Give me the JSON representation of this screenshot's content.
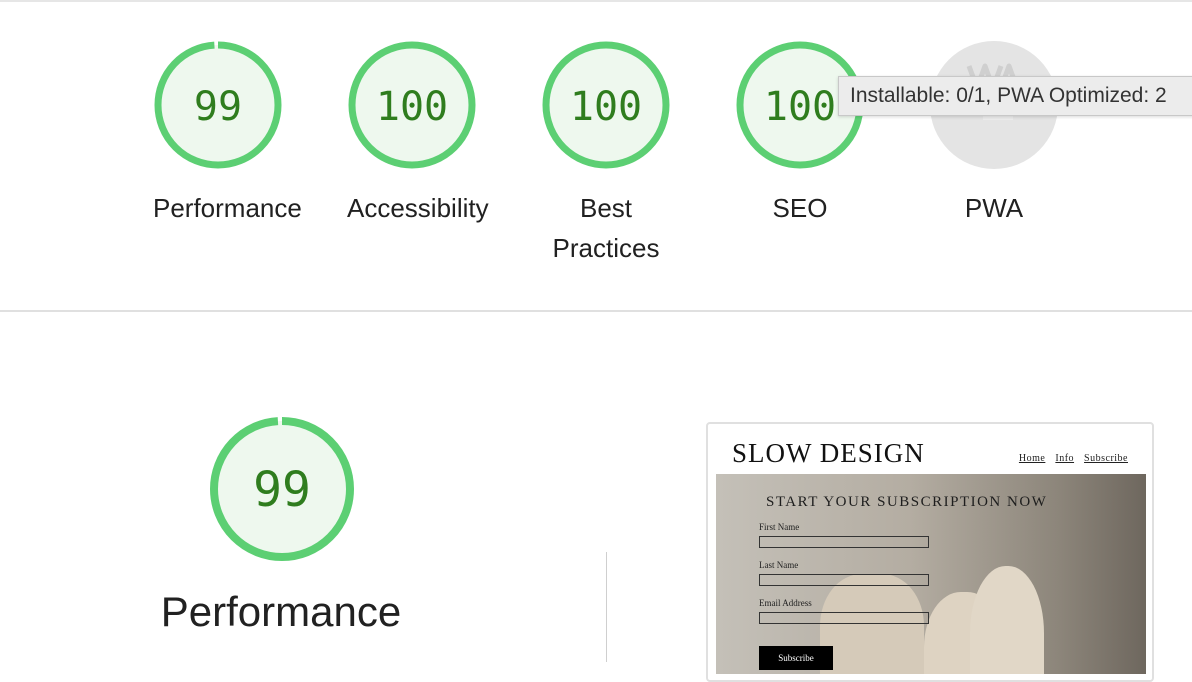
{
  "categories": [
    {
      "label": "Performance",
      "score": "99",
      "value": 99
    },
    {
      "label": "Accessibility",
      "score": "100",
      "value": 100
    },
    {
      "label": "Best Practices",
      "score": "100",
      "value": 100
    },
    {
      "label": "SEO",
      "score": "100",
      "value": 100
    },
    {
      "label": "PWA",
      "score": "",
      "value": null
    }
  ],
  "tooltip": "Installable: 0/1, PWA Optimized: 2",
  "performance": {
    "score": "99",
    "value": 99,
    "title": "Performance"
  },
  "preview": {
    "brand": "SLOW DESIGN",
    "nav": [
      "Home",
      "Info",
      "Subscribe"
    ],
    "hero_title": "START YOUR SUBSCRIPTION NOW",
    "fields": [
      "First Name",
      "Last Name",
      "Email Address"
    ],
    "button": "Subscribe"
  },
  "colors": {
    "pass_ring": "#5ccf73",
    "pass_fill": "#eef8ee",
    "pass_text": "#2f7d1e",
    "pwa_bg": "#e4e4e4"
  }
}
